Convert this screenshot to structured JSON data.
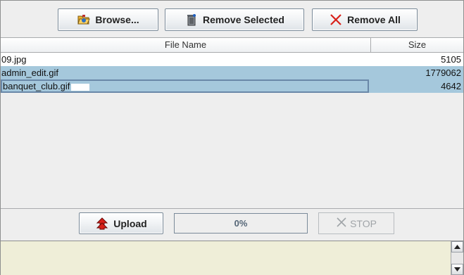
{
  "toolbar": {
    "browse_label": "Browse...",
    "remove_selected_label": "Remove Selected",
    "remove_all_label": "Remove All"
  },
  "table": {
    "columns": [
      "File Name",
      "Size"
    ],
    "rows": [
      {
        "name": "09.jpg",
        "size": "5105"
      },
      {
        "name": "admin_edit.gif",
        "size": "1779062"
      },
      {
        "name": "banquet_club.gif",
        "size": "4642"
      }
    ]
  },
  "upload": {
    "upload_label": "Upload",
    "progress_text": "0%",
    "progress_value": 0,
    "stop_label": "STOP"
  },
  "log": {
    "text": ""
  },
  "colors": {
    "selection": "#a5c8dc",
    "log_background": "#efeed8",
    "remove_x": "#d8201a"
  }
}
